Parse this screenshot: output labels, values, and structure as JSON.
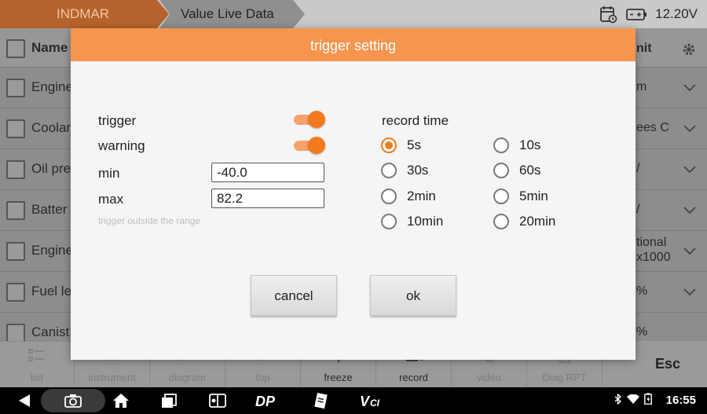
{
  "header": {
    "breadcrumb_1": "INDMAR",
    "breadcrumb_2": "Value Live Data",
    "voltage": "12.20V",
    "icons": [
      "calendar-clock-icon",
      "battery-icon"
    ]
  },
  "table": {
    "headers": {
      "name": "Name",
      "unit": "nit"
    },
    "rows": [
      {
        "name": "Engine",
        "unit": "m"
      },
      {
        "name": "Coolan",
        "unit": "ees C"
      },
      {
        "name": "Oil pre",
        "unit": "/"
      },
      {
        "name": "Batter",
        "unit": "/"
      },
      {
        "name": "Engine",
        "unit_line1": "tional",
        "unit_line2": "x1000"
      },
      {
        "name": "Fuel le",
        "unit": "%"
      },
      {
        "name": "Canist",
        "unit": "%"
      }
    ]
  },
  "toolbar": {
    "buttons": [
      "list",
      "instrument",
      "diagram",
      "top",
      "freeze",
      "record",
      "video",
      "Diag RPT"
    ],
    "esc_label": "Esc"
  },
  "navbar": {
    "clock": "16:55",
    "icons": [
      "back-icon",
      "screenshot-camera-icon",
      "home-icon",
      "recent-apps-icon",
      "app-icon",
      "dp-icon",
      "notes-icon",
      "vci-icon",
      "bluetooth-icon",
      "wifi-icon",
      "battery-icon"
    ]
  },
  "dialog": {
    "title": "trigger setting",
    "trigger_label": "trigger",
    "trigger_on": true,
    "warning_label": "warning",
    "warning_on": true,
    "min_label": "min",
    "min_value": "-40.0",
    "max_label": "max",
    "max_value": "82.2",
    "hint": "trigger outside the range",
    "record_time_label": "record time",
    "record_options": [
      "5s",
      "10s",
      "30s",
      "60s",
      "2min",
      "5min",
      "10min",
      "20min"
    ],
    "record_selected": "5s",
    "cancel_label": "cancel",
    "ok_label": "ok",
    "accent_color": "#f27a1e",
    "title_bar_color": "#f6954f"
  }
}
